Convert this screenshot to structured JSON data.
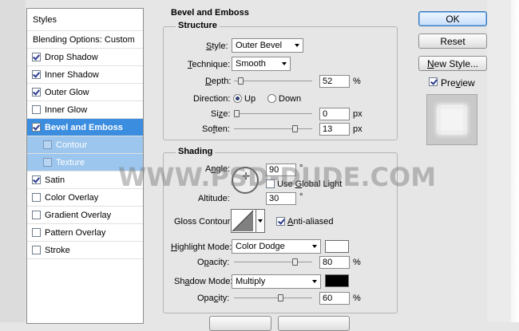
{
  "styles_panel": {
    "header": "Styles",
    "items": [
      {
        "label": "Blending Options: Custom",
        "checkbox": false,
        "checked": false
      },
      {
        "label": "Drop Shadow",
        "checkbox": true,
        "checked": true
      },
      {
        "label": "Inner Shadow",
        "checkbox": true,
        "checked": true
      },
      {
        "label": "Outer Glow",
        "checkbox": true,
        "checked": true
      },
      {
        "label": "Inner Glow",
        "checkbox": true,
        "checked": false
      },
      {
        "label": "Bevel and Emboss",
        "checkbox": true,
        "checked": true,
        "selected": true
      },
      {
        "label": "Contour",
        "checkbox": true,
        "checked": false,
        "sub": true
      },
      {
        "label": "Texture",
        "checkbox": true,
        "checked": false,
        "sub": true
      },
      {
        "label": "Satin",
        "checkbox": true,
        "checked": true
      },
      {
        "label": "Color Overlay",
        "checkbox": true,
        "checked": false
      },
      {
        "label": "Gradient Overlay",
        "checkbox": true,
        "checked": false
      },
      {
        "label": "Pattern Overlay",
        "checkbox": true,
        "checked": false
      },
      {
        "label": "Stroke",
        "checkbox": true,
        "checked": false
      }
    ]
  },
  "bevel": {
    "title": "Bevel and Emboss",
    "structure": {
      "title": "Structure",
      "style_label": "Style:",
      "style_value": "Outer Bevel",
      "technique_label": "Technique:",
      "technique_value": "Smooth",
      "depth_label": "Depth:",
      "depth_value": "52",
      "depth_unit": "%",
      "direction_label": "Direction:",
      "direction_up": "Up",
      "direction_down": "Down",
      "size_label": "Size:",
      "size_value": "0",
      "size_unit": "px",
      "soften_label": "Soften:",
      "soften_value": "13",
      "soften_unit": "px"
    },
    "shading": {
      "title": "Shading",
      "angle_label": "Angle:",
      "angle_value": "90",
      "angle_unit": "°",
      "use_global_light": "Use Global Light",
      "altitude_label": "Altitude:",
      "altitude_value": "30",
      "altitude_unit": "°",
      "gloss_contour_label": "Gloss Contour:",
      "anti_aliased": "Anti-aliased",
      "highlight_mode_label": "Highlight Mode:",
      "highlight_mode_value": "Color Dodge",
      "highlight_color": "#ffffff",
      "highlight_opacity_label": "Opacity:",
      "highlight_opacity_value": "80",
      "highlight_opacity_unit": "%",
      "shadow_mode_label": "Shadow Mode:",
      "shadow_mode_value": "Multiply",
      "shadow_color": "#000000",
      "shadow_opacity_label": "Opacity:",
      "shadow_opacity_value": "60",
      "shadow_opacity_unit": "%"
    },
    "sliders": {
      "depth": 0.05,
      "size": 0.0,
      "soften": 0.8,
      "highlight_opacity": 0.8,
      "shadow_opacity": 0.6
    }
  },
  "buttons": {
    "ok": "OK",
    "reset": "Reset",
    "new_style": "New Style...",
    "preview": "Preview"
  },
  "watermark": "WWW.PSD-DUDE.COM",
  "colors": {
    "accent": "#3b8de0",
    "accent_sub": "#9cc6ee"
  }
}
